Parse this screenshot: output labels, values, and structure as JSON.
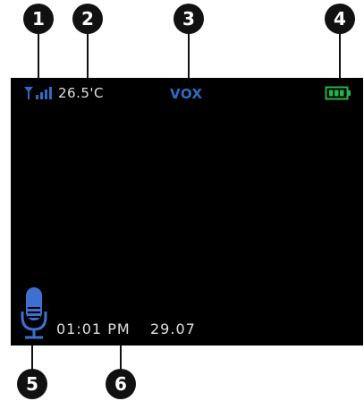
{
  "colors": {
    "accent_blue": "#2e6cc4",
    "battery_green": "#25b34a",
    "screen_bg": "#000000",
    "text": "#e0e0e0",
    "callout_bg": "#111111"
  },
  "callouts": [
    {
      "label": "1"
    },
    {
      "label": "2"
    },
    {
      "label": "3"
    },
    {
      "label": "4"
    },
    {
      "label": "5"
    },
    {
      "label": "6"
    }
  ],
  "status_bar": {
    "signal_icon": "signal-antenna-icon",
    "temperature": "26.5'C",
    "mode": "VOX",
    "battery_icon": "battery-full-icon"
  },
  "bottom_bar": {
    "mic_icon": "microphone-icon",
    "time": "01:01 PM",
    "date": "29.07"
  }
}
